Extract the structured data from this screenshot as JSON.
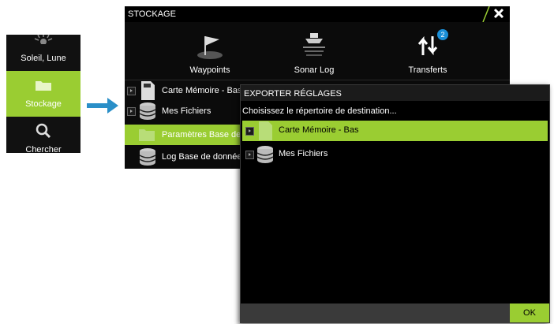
{
  "side_menu": {
    "items": [
      {
        "label": "Soleil, Lune",
        "icon": "sun-moon-icon"
      },
      {
        "label": "Stockage",
        "icon": "folder-icon",
        "selected": true
      },
      {
        "label": "Chercher",
        "icon": "search-icon"
      }
    ]
  },
  "stockage": {
    "title": "STOCKAGE",
    "tabs": [
      {
        "label": "Waypoints",
        "icon": "waypoint-flag-icon"
      },
      {
        "label": "Sonar Log",
        "icon": "sonar-log-icon"
      },
      {
        "label": "Transferts",
        "icon": "transfer-arrows-icon",
        "badge": "2"
      }
    ],
    "rows": [
      {
        "label": "Carte Mémoire - Bas"
      },
      {
        "label": "Mes Fichiers"
      },
      {
        "label": "Paramètres Base de d",
        "selected": true
      },
      {
        "label": "Log Base de données"
      }
    ]
  },
  "dialog": {
    "title": "EXPORTER RÉGLAGES",
    "subtitle": "Choisissez le répertoire de destination...",
    "rows": [
      {
        "label": "Carte Mémoire - Bas",
        "selected": true
      },
      {
        "label": "Mes Fichiers"
      }
    ],
    "ok_label": "OK"
  },
  "colors": {
    "accent": "#9acd32",
    "badge": "#1a8fd8",
    "arrow": "#2a8fc8"
  }
}
